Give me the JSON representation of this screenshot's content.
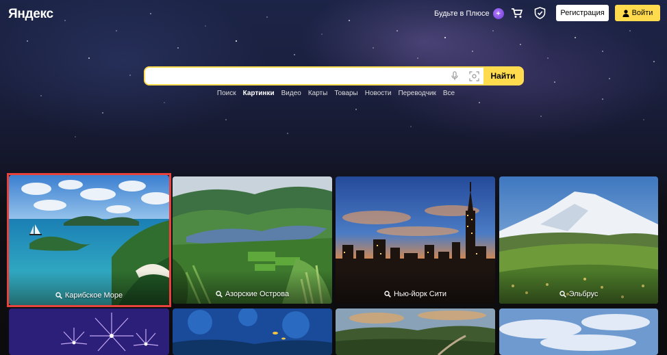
{
  "header": {
    "logo": "Яндекс",
    "plus_label": "Будьте в Плюсе",
    "register_label": "Регистрация",
    "login_label": "Войти"
  },
  "search": {
    "value": "",
    "button_label": "Найти"
  },
  "services": [
    "Поиск",
    "Картинки",
    "Видео",
    "Карты",
    "Товары",
    "Новости",
    "Переводчик",
    "Все"
  ],
  "active_service": "Картинки",
  "tiles": [
    {
      "label": "Карибское Море",
      "selected": true
    },
    {
      "label": "Азорские Острова",
      "selected": false
    },
    {
      "label": "Нью-йорк Сити",
      "selected": false
    },
    {
      "label": "Эльбрус",
      "selected": false
    },
    {
      "label": "",
      "selected": false
    },
    {
      "label": "",
      "selected": false
    },
    {
      "label": "",
      "selected": false
    },
    {
      "label": "",
      "selected": false
    }
  ],
  "colors": {
    "accent": "#ffdb4d",
    "selection": "#e8423d"
  }
}
